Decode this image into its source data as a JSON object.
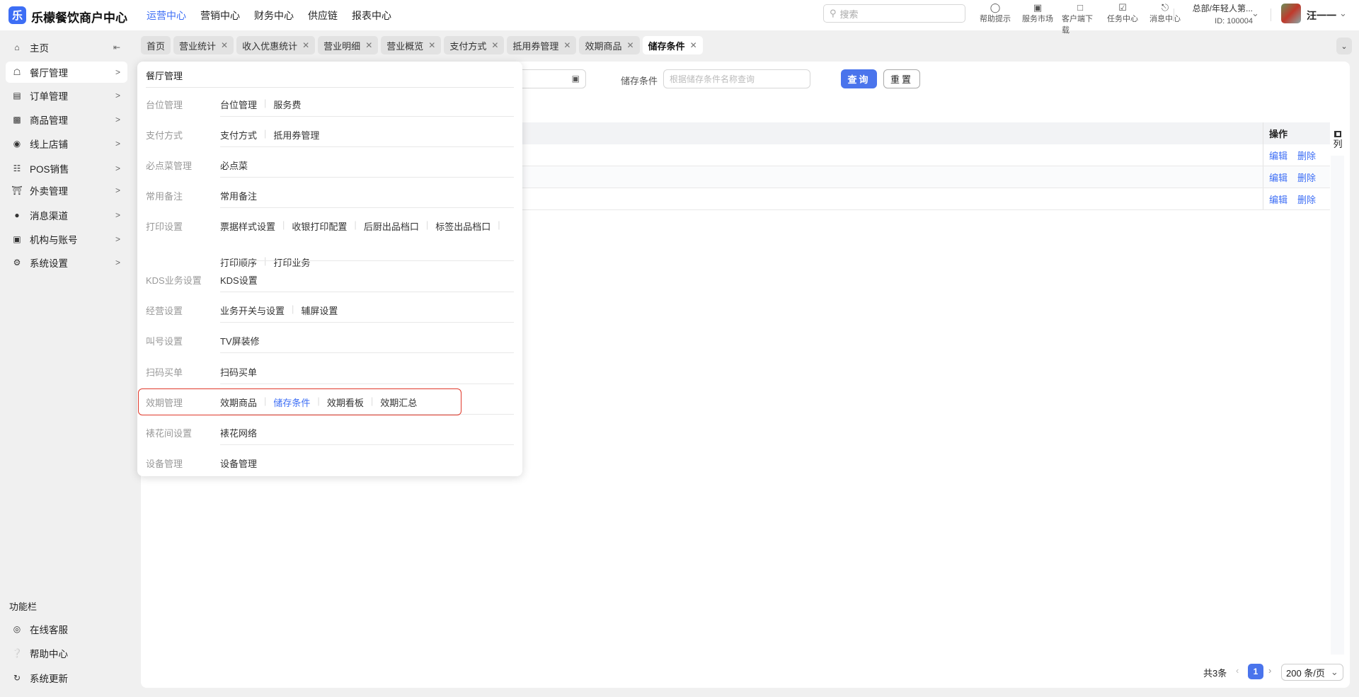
{
  "header": {
    "logo_glyph": "乐",
    "brand": "乐檬餐饮商户中心",
    "nav": [
      "运营中心",
      "营销中心",
      "财务中心",
      "供应链",
      "报表中心"
    ],
    "active_nav": 0,
    "search_placeholder": "搜索",
    "tools": [
      {
        "icon": "lightbulb-icon",
        "label": "帮助提示"
      },
      {
        "icon": "shop-bag-icon",
        "label": "服务市场"
      },
      {
        "icon": "folder-download-icon",
        "label": "客户端下载"
      },
      {
        "icon": "clipboard-check-icon",
        "label": "任务中心"
      },
      {
        "icon": "bell-icon",
        "label": "消息中心"
      }
    ],
    "org": "总部/年轻人第...",
    "org_id": "ID: 100004",
    "user": "汪一一"
  },
  "sidebar": {
    "items": [
      {
        "label": "主页",
        "icon": "home-icon"
      },
      {
        "label": "餐厅管理",
        "icon": "store-icon"
      },
      {
        "label": "订单管理",
        "icon": "order-icon"
      },
      {
        "label": "商品管理",
        "icon": "goods-icon"
      },
      {
        "label": "线上店铺",
        "icon": "globe-icon"
      },
      {
        "label": "POS销售",
        "icon": "cart-icon"
      },
      {
        "label": "外卖管理",
        "icon": "bank-icon"
      },
      {
        "label": "消息渠道",
        "icon": "chat-icon"
      },
      {
        "label": "机构与账号",
        "icon": "id-card-icon"
      },
      {
        "label": "系统设置",
        "icon": "gear-icon"
      }
    ],
    "footer_title": "功能栏",
    "footer": [
      {
        "label": "在线客服",
        "icon": "headset-icon"
      },
      {
        "label": "帮助中心",
        "icon": "question-icon"
      },
      {
        "label": "系统更新",
        "icon": "refresh-icon"
      }
    ]
  },
  "tabs": [
    "首页",
    "营业统计",
    "收入优惠统计",
    "营业明细",
    "营业概览",
    "支付方式",
    "抵用券管理",
    "效期商品",
    "储存条件"
  ],
  "filter": {
    "label": "储存条件",
    "placeholder": "根据储存条件名称查询",
    "query": "查询",
    "reset": "重置"
  },
  "table": {
    "op_header": "操作",
    "column_setting": "列",
    "rows": [
      {
        "edit": "编辑",
        "delete": "删除"
      },
      {
        "edit": "编辑",
        "delete": "删除"
      },
      {
        "edit": "编辑",
        "delete": "删除"
      }
    ]
  },
  "pagination": {
    "total": "共3条",
    "current": "1",
    "page_size": "200 条/页"
  },
  "menu": {
    "title": "餐厅管理",
    "groups": [
      {
        "label": "台位管理",
        "items": [
          "台位管理",
          "服务费"
        ]
      },
      {
        "label": "支付方式",
        "items": [
          "支付方式",
          "抵用券管理"
        ]
      },
      {
        "label": "必点菜管理",
        "items": [
          "必点菜"
        ]
      },
      {
        "label": "常用备注",
        "items": [
          "常用备注"
        ]
      },
      {
        "label": "打印设置",
        "items": [
          "票据样式设置",
          "收银打印配置",
          "后厨出品档口",
          "标签出品档口",
          "打印顺序",
          "打印业务"
        ]
      },
      {
        "label": "KDS业务设置",
        "items": [
          "KDS设置"
        ]
      },
      {
        "label": "经营设置",
        "items": [
          "业务开关与设置",
          "辅屏设置"
        ]
      },
      {
        "label": "叫号设置",
        "items": [
          "TV屏装修"
        ]
      },
      {
        "label": "扫码买单",
        "items": [
          "扫码买单"
        ]
      },
      {
        "label": "效期管理",
        "items": [
          "效期商品",
          "储存条件",
          "效期看板",
          "效期汇总"
        ],
        "highlighted": true,
        "current": "储存条件"
      },
      {
        "label": "裱花间设置",
        "items": [
          "裱花网络"
        ]
      },
      {
        "label": "设备管理",
        "items": [
          "设备管理"
        ]
      }
    ]
  },
  "colors": {
    "accent": "#3d6ef5",
    "highlight_border": "#e0392b"
  }
}
